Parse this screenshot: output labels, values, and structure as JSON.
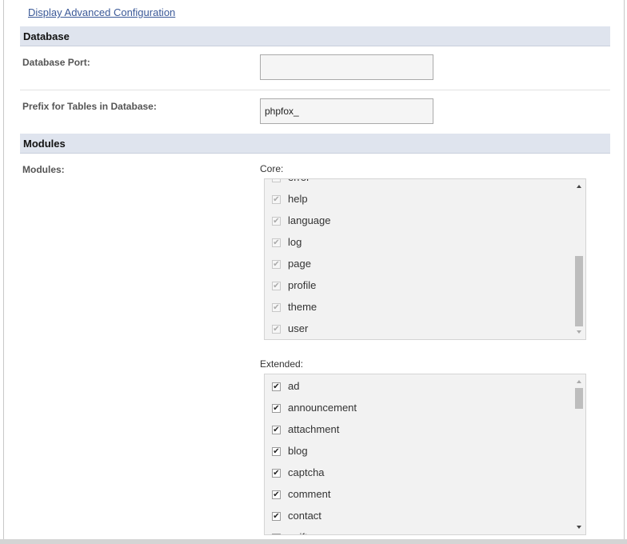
{
  "advanced_link": "Display Advanced Configuration",
  "database_section": {
    "title": "Database",
    "port_label": "Database Port:",
    "port_value": "",
    "prefix_label": "Prefix for Tables in Database:",
    "prefix_value": "phpfox_"
  },
  "modules_section": {
    "title": "Modules",
    "modules_label": "Modules:",
    "core": {
      "label": "Core:",
      "items": [
        {
          "label": "error",
          "checked": true
        },
        {
          "label": "help",
          "checked": true
        },
        {
          "label": "language",
          "checked": true
        },
        {
          "label": "log",
          "checked": true
        },
        {
          "label": "page",
          "checked": true
        },
        {
          "label": "profile",
          "checked": true
        },
        {
          "label": "theme",
          "checked": true
        },
        {
          "label": "user",
          "checked": true
        }
      ]
    },
    "extended": {
      "label": "Extended:",
      "items": [
        {
          "label": "ad",
          "checked": true
        },
        {
          "label": "announcement",
          "checked": true
        },
        {
          "label": "attachment",
          "checked": true
        },
        {
          "label": "blog",
          "checked": true
        },
        {
          "label": "captcha",
          "checked": true
        },
        {
          "label": "comment",
          "checked": true
        },
        {
          "label": "contact",
          "checked": true
        },
        {
          "label": "egift",
          "checked": true
        }
      ]
    }
  },
  "icons": {
    "check": "check-icon",
    "scroll_up": "scroll-up-arrow-icon",
    "scroll_down": "scroll-down-arrow-icon"
  },
  "colors": {
    "section_header_bg": "#dfe4ee",
    "link": "#3b5998",
    "listbox_bg": "#f2f2f2"
  }
}
